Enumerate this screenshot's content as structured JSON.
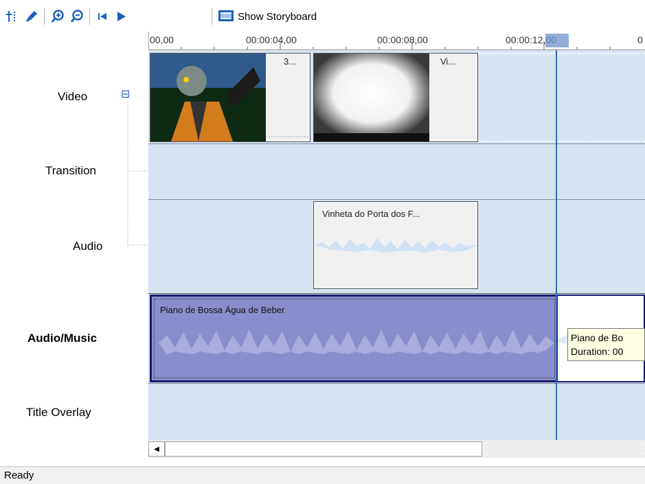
{
  "toolbar": {
    "icons": [
      "set-audio-levels-icon",
      "narrate-timeline-icon",
      "zoom-in-icon",
      "zoom-out-icon",
      "rewind-icon",
      "play-icon",
      "storyboard-icon"
    ],
    "storyboard_label": "Show Storyboard"
  },
  "ruler": {
    "ticks": [
      "00,00",
      "00:00:04,00",
      "00:00:08,00",
      "00:00:12,00"
    ],
    "tick_last_partial": "0"
  },
  "tracks": {
    "video": "Video",
    "video_collapse": "⊟",
    "transition": "Transition",
    "audio": "Audio",
    "audio_music": "Audio/Music",
    "title_overlay": "Title Overlay"
  },
  "clips": {
    "video1_label": "3...",
    "video2_label": "Vi...",
    "audio1_label": "Vinheta do Porta dos F...",
    "music1_label": "Piano de Bossa   Água de Beber"
  },
  "tooltip": {
    "line1": "Piano de Bo",
    "line2": "Duration: 00"
  },
  "status": {
    "text": "Ready"
  },
  "colors": {
    "timeline_bg": "#d6e4f2",
    "music_clip": "#8a8dcc",
    "playhead": "#2d6bc3",
    "tooltip_bg": "#ffffe1"
  }
}
